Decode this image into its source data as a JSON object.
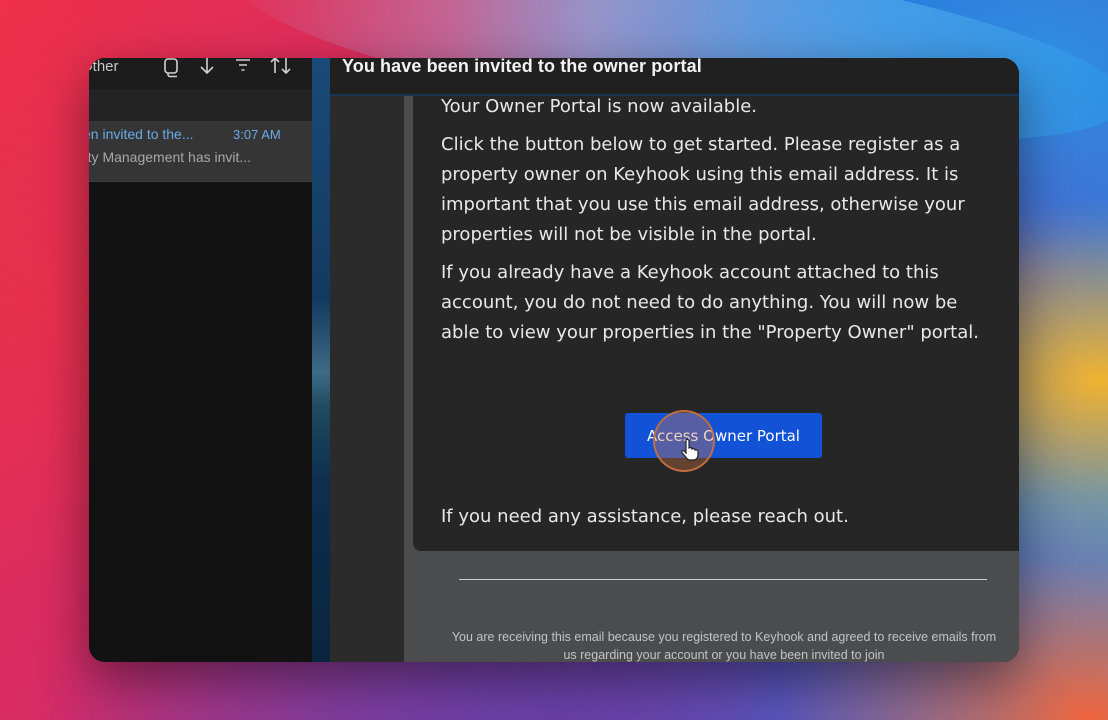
{
  "mail_list": {
    "toolbar": {
      "folder_label": "Other"
    },
    "items": [
      {
        "subject": "en invited to the...",
        "time": "3:07 AM",
        "preview": "rty Management has invit..."
      }
    ]
  },
  "reading_pane": {
    "subject": "You have been invited to the owner portal",
    "body": {
      "paragraphs": [
        "Your Owner Portal is now available.",
        "Click the button below to get started. Please register as a property owner on Keyhook using this email address. It is important that you use this email address, otherwise your properties will not be visible in the portal.",
        "If you already have a Keyhook account attached to this account, you do not need to do anything. You will now be able to view your properties in the \"Property Owner\" portal."
      ],
      "cta_label": "Access Owner Portal",
      "closing": "If you need any assistance, please reach out."
    },
    "footer": "You are receiving this email because you registered to Keyhook and agreed to receive emails from us regarding your account or you have been invited to join"
  },
  "colors": {
    "cta_background": "#1152d6",
    "link_blue": "#6aaae8"
  },
  "icons": [
    "copy-icon",
    "arrow-down-icon",
    "filter-icon",
    "sort-icon",
    "hand-pointer-icon"
  ]
}
